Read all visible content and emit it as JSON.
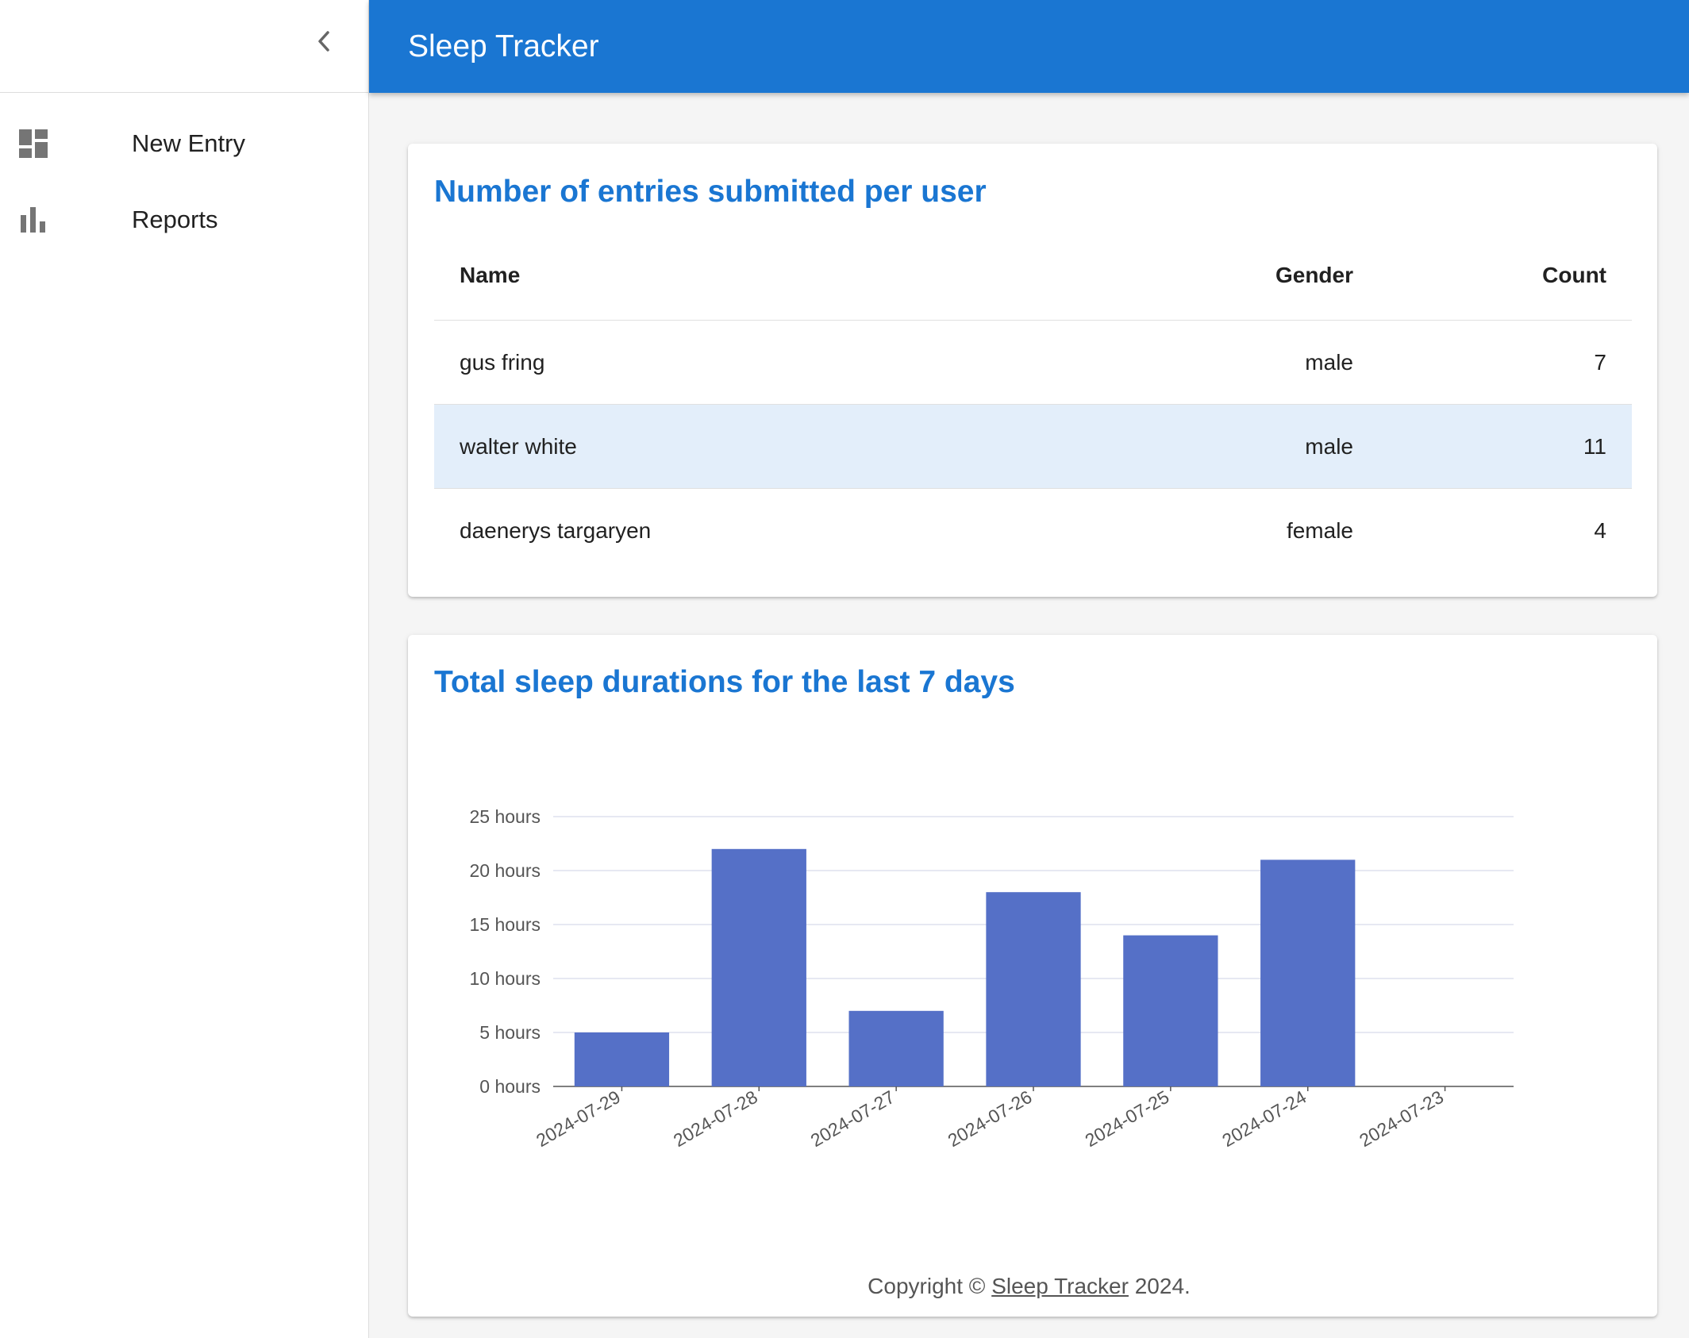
{
  "app": {
    "title": "Sleep Tracker"
  },
  "sidebar": {
    "items": [
      {
        "label": "New Entry",
        "icon": "dashboard-icon"
      },
      {
        "label": "Reports",
        "icon": "bar-chart-icon"
      }
    ]
  },
  "entries_card": {
    "title": "Number of entries submitted per user",
    "columns": {
      "name": "Name",
      "gender": "Gender",
      "count": "Count"
    },
    "rows": [
      {
        "name": "gus fring",
        "gender": "male",
        "count": "7"
      },
      {
        "name": "walter white",
        "gender": "male",
        "count": "11"
      },
      {
        "name": "daenerys targaryen",
        "gender": "female",
        "count": "4"
      }
    ]
  },
  "sleep_card": {
    "title": "Total sleep durations for the last 7 days"
  },
  "footer": {
    "prefix": "Copyright © ",
    "link": "Sleep Tracker",
    "suffix": " 2024."
  },
  "colors": {
    "primary": "#1a76d2",
    "bar": "#5570c7",
    "highlight_row": "#e3eefa"
  },
  "chart_data": {
    "type": "bar",
    "categories": [
      "2024-07-29",
      "2024-07-28",
      "2024-07-27",
      "2024-07-26",
      "2024-07-25",
      "2024-07-24",
      "2024-07-23"
    ],
    "values": [
      5,
      22,
      7,
      18,
      14,
      21,
      0
    ],
    "ylim": [
      0,
      25
    ],
    "yticks": [
      0,
      5,
      10,
      15,
      20,
      25
    ],
    "ytick_labels": [
      "0 hours",
      "5 hours",
      "10 hours",
      "15 hours",
      "20 hours",
      "25 hours"
    ],
    "grid": true
  }
}
